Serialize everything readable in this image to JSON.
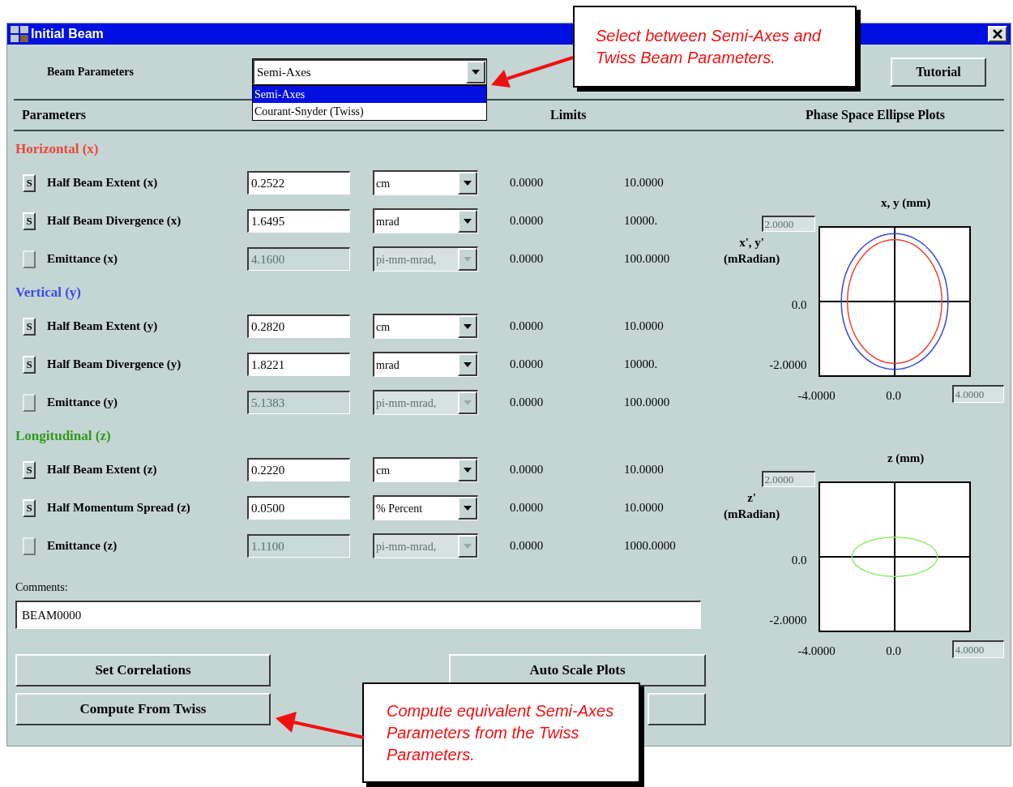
{
  "window": {
    "title": "Initial Beam"
  },
  "beam_parameters": {
    "label": "Beam Parameters",
    "value": "Semi-Axes",
    "expanded": true,
    "options": [
      {
        "label": "Semi-Axes",
        "selected": true
      },
      {
        "label": "Courant-Snyder (Twiss)",
        "selected": false
      }
    ]
  },
  "tutorial_button": "Tutorial",
  "headers": {
    "parameters": "Parameters",
    "limits": "Limits",
    "plots": "Phase Space Ellipse Plots"
  },
  "sections": [
    {
      "title": "Horizontal (x)",
      "color": "#e8463a",
      "rows": [
        {
          "button": "S",
          "name": "Half Beam Extent (x)",
          "value": "0.2522",
          "unit": "cm",
          "min": "0.0000",
          "max": "10.0000",
          "disabled": false
        },
        {
          "button": "S",
          "name": "Half Beam Divergence (x)",
          "value": "1.6495",
          "unit": "mrad",
          "min": "0.0000",
          "max": "10000.",
          "disabled": false
        },
        {
          "name": "Emittance (x)",
          "value": "4.1600",
          "unit": "pi-mm-mrad,",
          "min": "0.0000",
          "max": "100.0000",
          "disabled": true
        }
      ]
    },
    {
      "title": "Vertical (y)",
      "color": "#3a4ae0",
      "rows": [
        {
          "button": "S",
          "name": "Half Beam Extent (y)",
          "value": "0.2820",
          "unit": "cm",
          "min": "0.0000",
          "max": "10.0000",
          "disabled": false
        },
        {
          "button": "S",
          "name": "Half Beam Divergence (y)",
          "value": "1.8221",
          "unit": "mrad",
          "min": "0.0000",
          "max": "10000.",
          "disabled": false
        },
        {
          "name": "Emittance (y)",
          "value": "5.1383",
          "unit": "pi-mm-mrad,",
          "min": "0.0000",
          "max": "100.0000",
          "disabled": true
        }
      ]
    },
    {
      "title": "Longitudinal (z)",
      "color": "#2f9a1a",
      "rows": [
        {
          "button": "S",
          "name": "Half Beam Extent (z)",
          "value": "0.2220",
          "unit": "cm",
          "min": "0.0000",
          "max": "10.0000",
          "disabled": false
        },
        {
          "button": "S",
          "name": "Half Momentum Spread (z)",
          "value": "0.0500",
          "unit": "% Percent",
          "min": "0.0000",
          "max": "10.0000",
          "disabled": false
        },
        {
          "name": "Emittance (z)",
          "value": "1.1100",
          "unit": "pi-mm-mrad,",
          "min": "0.0000",
          "max": "1000.0000",
          "disabled": true
        }
      ]
    }
  ],
  "comments": {
    "label": "Comments:",
    "value": "BEAM0000"
  },
  "buttons": [
    "Set Correlations",
    "Compute From Twiss"
  ],
  "right_buttons": [
    "Auto Scale Plots"
  ],
  "plots": [
    {
      "title": "x, y (mm)",
      "ylabel": [
        "x', y'",
        "(mRadian)"
      ],
      "ymax": "2.0000",
      "ymid": "0.0",
      "ymin": "-2.0000",
      "xmin": "-4.0000",
      "xmid": "0.0",
      "xmax": "4.0000",
      "ellipses": [
        {
          "color": "#3a4ae0"
        },
        {
          "color": "#e8463a"
        }
      ]
    },
    {
      "title": "z (mm)",
      "ylabel": [
        "z'",
        "(mRadian)"
      ],
      "ymax": "2.0000",
      "ymid": "0.0",
      "ymin": "-2.0000",
      "xmin": "-4.0000",
      "xmid": "0.0",
      "xmax": "4.0000",
      "ellipses": [
        {
          "color": "#8eea6a"
        }
      ]
    }
  ],
  "callouts": [
    {
      "text": "Select between Semi-Axes and Twiss Beam Parameters."
    },
    {
      "text": "Compute equivalent Semi-Axes Parameters from the Twiss Parameters."
    }
  ]
}
